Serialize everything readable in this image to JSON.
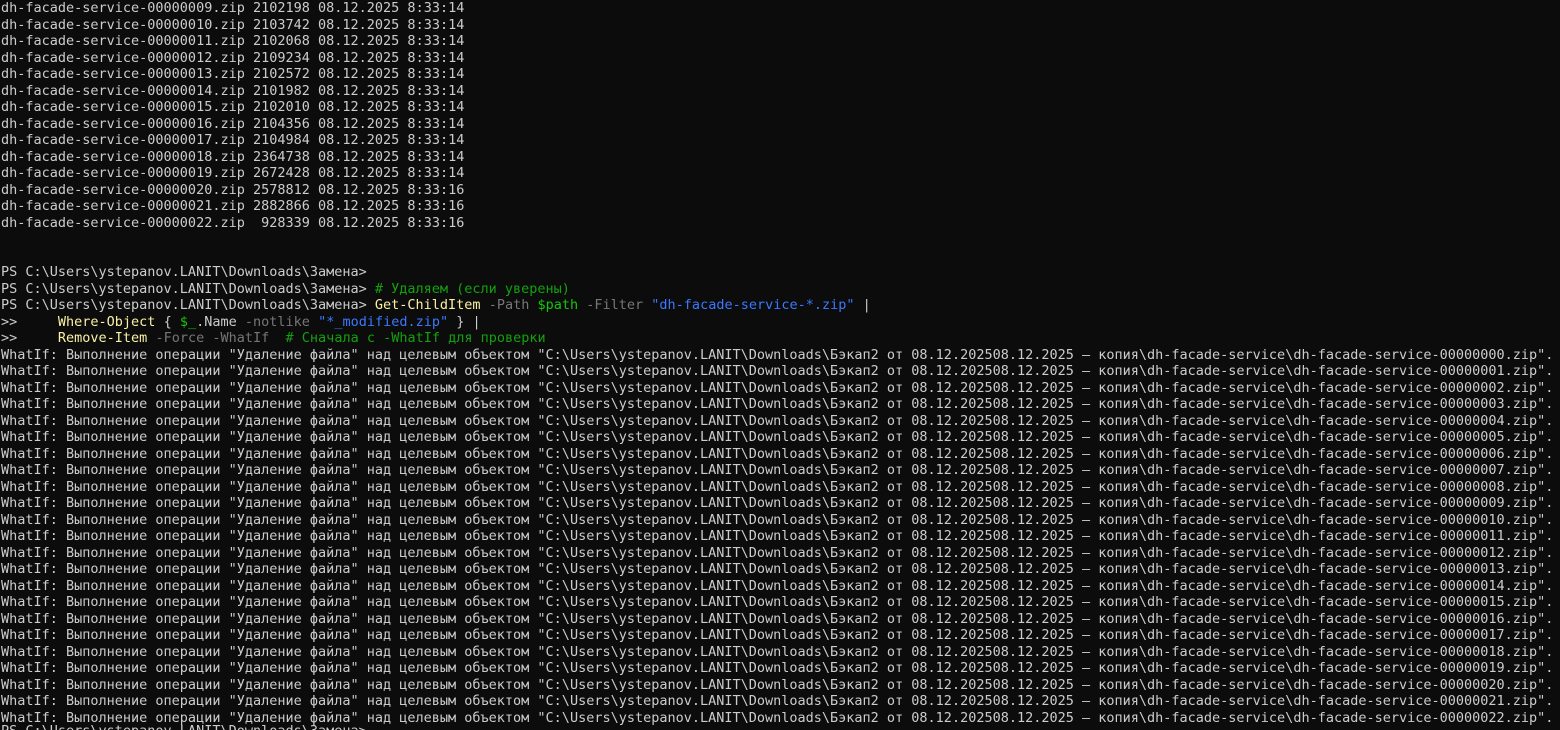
{
  "file_rows": [
    {
      "name": "dh-facade-service-00000009.zip",
      "size": "2102198",
      "date": "08.12.2025 8:33:14"
    },
    {
      "name": "dh-facade-service-00000010.zip",
      "size": "2103742",
      "date": "08.12.2025 8:33:14"
    },
    {
      "name": "dh-facade-service-00000011.zip",
      "size": "2102068",
      "date": "08.12.2025 8:33:14"
    },
    {
      "name": "dh-facade-service-00000012.zip",
      "size": "2109234",
      "date": "08.12.2025 8:33:14"
    },
    {
      "name": "dh-facade-service-00000013.zip",
      "size": "2102572",
      "date": "08.12.2025 8:33:14"
    },
    {
      "name": "dh-facade-service-00000014.zip",
      "size": "2101982",
      "date": "08.12.2025 8:33:14"
    },
    {
      "name": "dh-facade-service-00000015.zip",
      "size": "2102010",
      "date": "08.12.2025 8:33:14"
    },
    {
      "name": "dh-facade-service-00000016.zip",
      "size": "2104356",
      "date": "08.12.2025 8:33:14"
    },
    {
      "name": "dh-facade-service-00000017.zip",
      "size": "2104984",
      "date": "08.12.2025 8:33:14"
    },
    {
      "name": "dh-facade-service-00000018.zip",
      "size": "2364738",
      "date": "08.12.2025 8:33:14"
    },
    {
      "name": "dh-facade-service-00000019.zip",
      "size": "2672428",
      "date": "08.12.2025 8:33:14"
    },
    {
      "name": "dh-facade-service-00000020.zip",
      "size": "2578812",
      "date": "08.12.2025 8:33:16"
    },
    {
      "name": "dh-facade-service-00000021.zip",
      "size": "2882866",
      "date": "08.12.2025 8:33:16"
    },
    {
      "name": "dh-facade-service-00000022.zip",
      "size": " 928339",
      "date": "08.12.2025 8:33:16"
    }
  ],
  "prompt": "PS C:\\Users\\ystepanov.LANIT\\Downloads\\Замена> ",
  "continuation": ">>     ",
  "commands": {
    "comment_delete": "# Удаляем (если уверены)",
    "get_childitem": "Get-ChildItem",
    "param_path": "-Path",
    "var_path": "$path",
    "param_filter": "-Filter",
    "str_filter": "\"dh-facade-service-*.zip\"",
    "pipe": " |",
    "where_object": "Where-Object",
    "brace_open": " { ",
    "var_item": "$_",
    "prop_name": ".Name ",
    "param_notlike": "-notlike",
    "str_modified": "\"*_modified.zip\"",
    "brace_close_pipe": " } |",
    "remove_item": "Remove-Item",
    "param_force": "-Force",
    "param_whatif": "-WhatIf",
    "comment_whatif": "# Сначала с -WhatIf для проверки"
  },
  "whatif_prefix": "WhatIf: Выполнение операции \"Удаление файла\" над целевым объектом \"C:\\Users\\ystepanov.LANIT\\Downloads\\Бэкап2 от 08.12.202508.12.2025 – копия\\dh-facade-service\\",
  "whatif_suffix": "\".",
  "whatif_files": [
    "dh-facade-service-00000000.zip",
    "dh-facade-service-00000001.zip",
    "dh-facade-service-00000002.zip",
    "dh-facade-service-00000003.zip",
    "dh-facade-service-00000004.zip",
    "dh-facade-service-00000005.zip",
    "dh-facade-service-00000006.zip",
    "dh-facade-service-00000007.zip",
    "dh-facade-service-00000008.zip",
    "dh-facade-service-00000009.zip",
    "dh-facade-service-00000010.zip",
    "dh-facade-service-00000011.zip",
    "dh-facade-service-00000012.zip",
    "dh-facade-service-00000013.zip",
    "dh-facade-service-00000014.zip",
    "dh-facade-service-00000015.zip",
    "dh-facade-service-00000016.zip",
    "dh-facade-service-00000017.zip",
    "dh-facade-service-00000018.zip",
    "dh-facade-service-00000019.zip",
    "dh-facade-service-00000020.zip",
    "dh-facade-service-00000021.zip",
    "dh-facade-service-00000022.zip"
  ],
  "colors": {
    "background": "#0c0c0c",
    "foreground": "#cccccc",
    "command": "#f9f1a5",
    "parameter": "#767676",
    "string": "#3b78ff",
    "variable": "#16c60c",
    "comment": "#13a10e"
  }
}
